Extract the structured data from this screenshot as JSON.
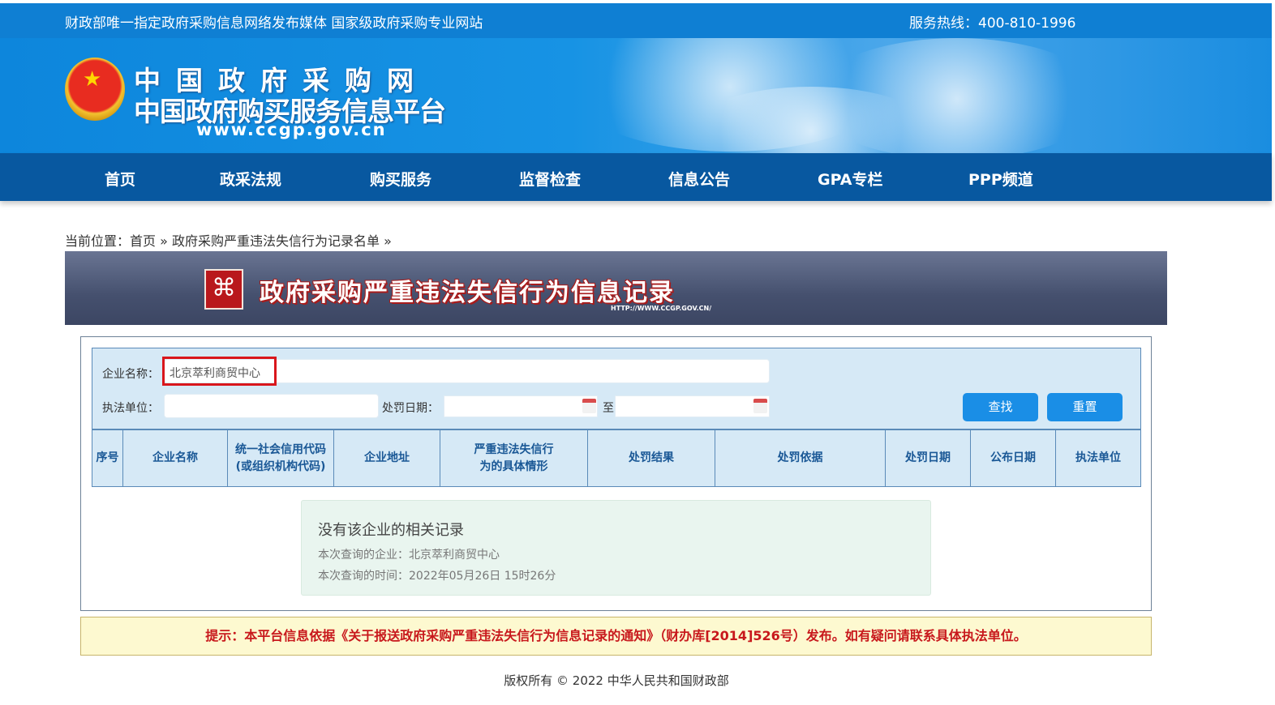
{
  "topbar": {
    "slogan": "财政部唯一指定政府采购信息网络发布媒体 国家级政府采购专业网站",
    "hotline": "服务热线：400-810-1996"
  },
  "logo": {
    "line1": "中国政府采购网",
    "line2": "中国政府购买服务信息平台",
    "url": "www.ccgp.gov.cn"
  },
  "nav": [
    "首页",
    "政采法规",
    "购买服务",
    "监督检查",
    "信息公告",
    "GPA专栏",
    "PPP频道"
  ],
  "breadcrumb": {
    "prefix": "当前位置：",
    "home": "首页",
    "sep": "»",
    "current": "政府采购严重违法失信行为记录名单",
    "end": "»"
  },
  "title_banner": {
    "title": "政府采购严重违法失信行为信息记录",
    "url": "HTTP://WWW.CCGP.GOV.CN/"
  },
  "search": {
    "company_label": "企业名称：",
    "company_value": "北京萃利商贸中心",
    "agency_label": "执法单位：",
    "agency_value": "",
    "date_label": "处罚日期：",
    "date_from": "",
    "to_label": "至",
    "date_to": "",
    "search_btn": "查找",
    "reset_btn": "重置"
  },
  "table": {
    "headers": [
      "序号",
      "企业名称",
      "统一社会信用代码(或组织机构代码)",
      "企业地址",
      "严重违法失信行为的具体情形",
      "处罚结果",
      "处罚依据",
      "处罚日期",
      "公布日期",
      "执法单位"
    ]
  },
  "result": {
    "title": "没有该企业的相关记录",
    "company": "本次查询的企业：北京萃利商贸中心",
    "time": "本次查询的时间：2022年05月26日 15时26分"
  },
  "tip": "提示：本平台信息依据《关于报送政府采购严重违法失信行为信息记录的通知》（财办库[2014]526号）发布。如有疑问请联系具体执法单位。",
  "footer": "版权所有 © 2022 中华人民共和国财政部"
}
